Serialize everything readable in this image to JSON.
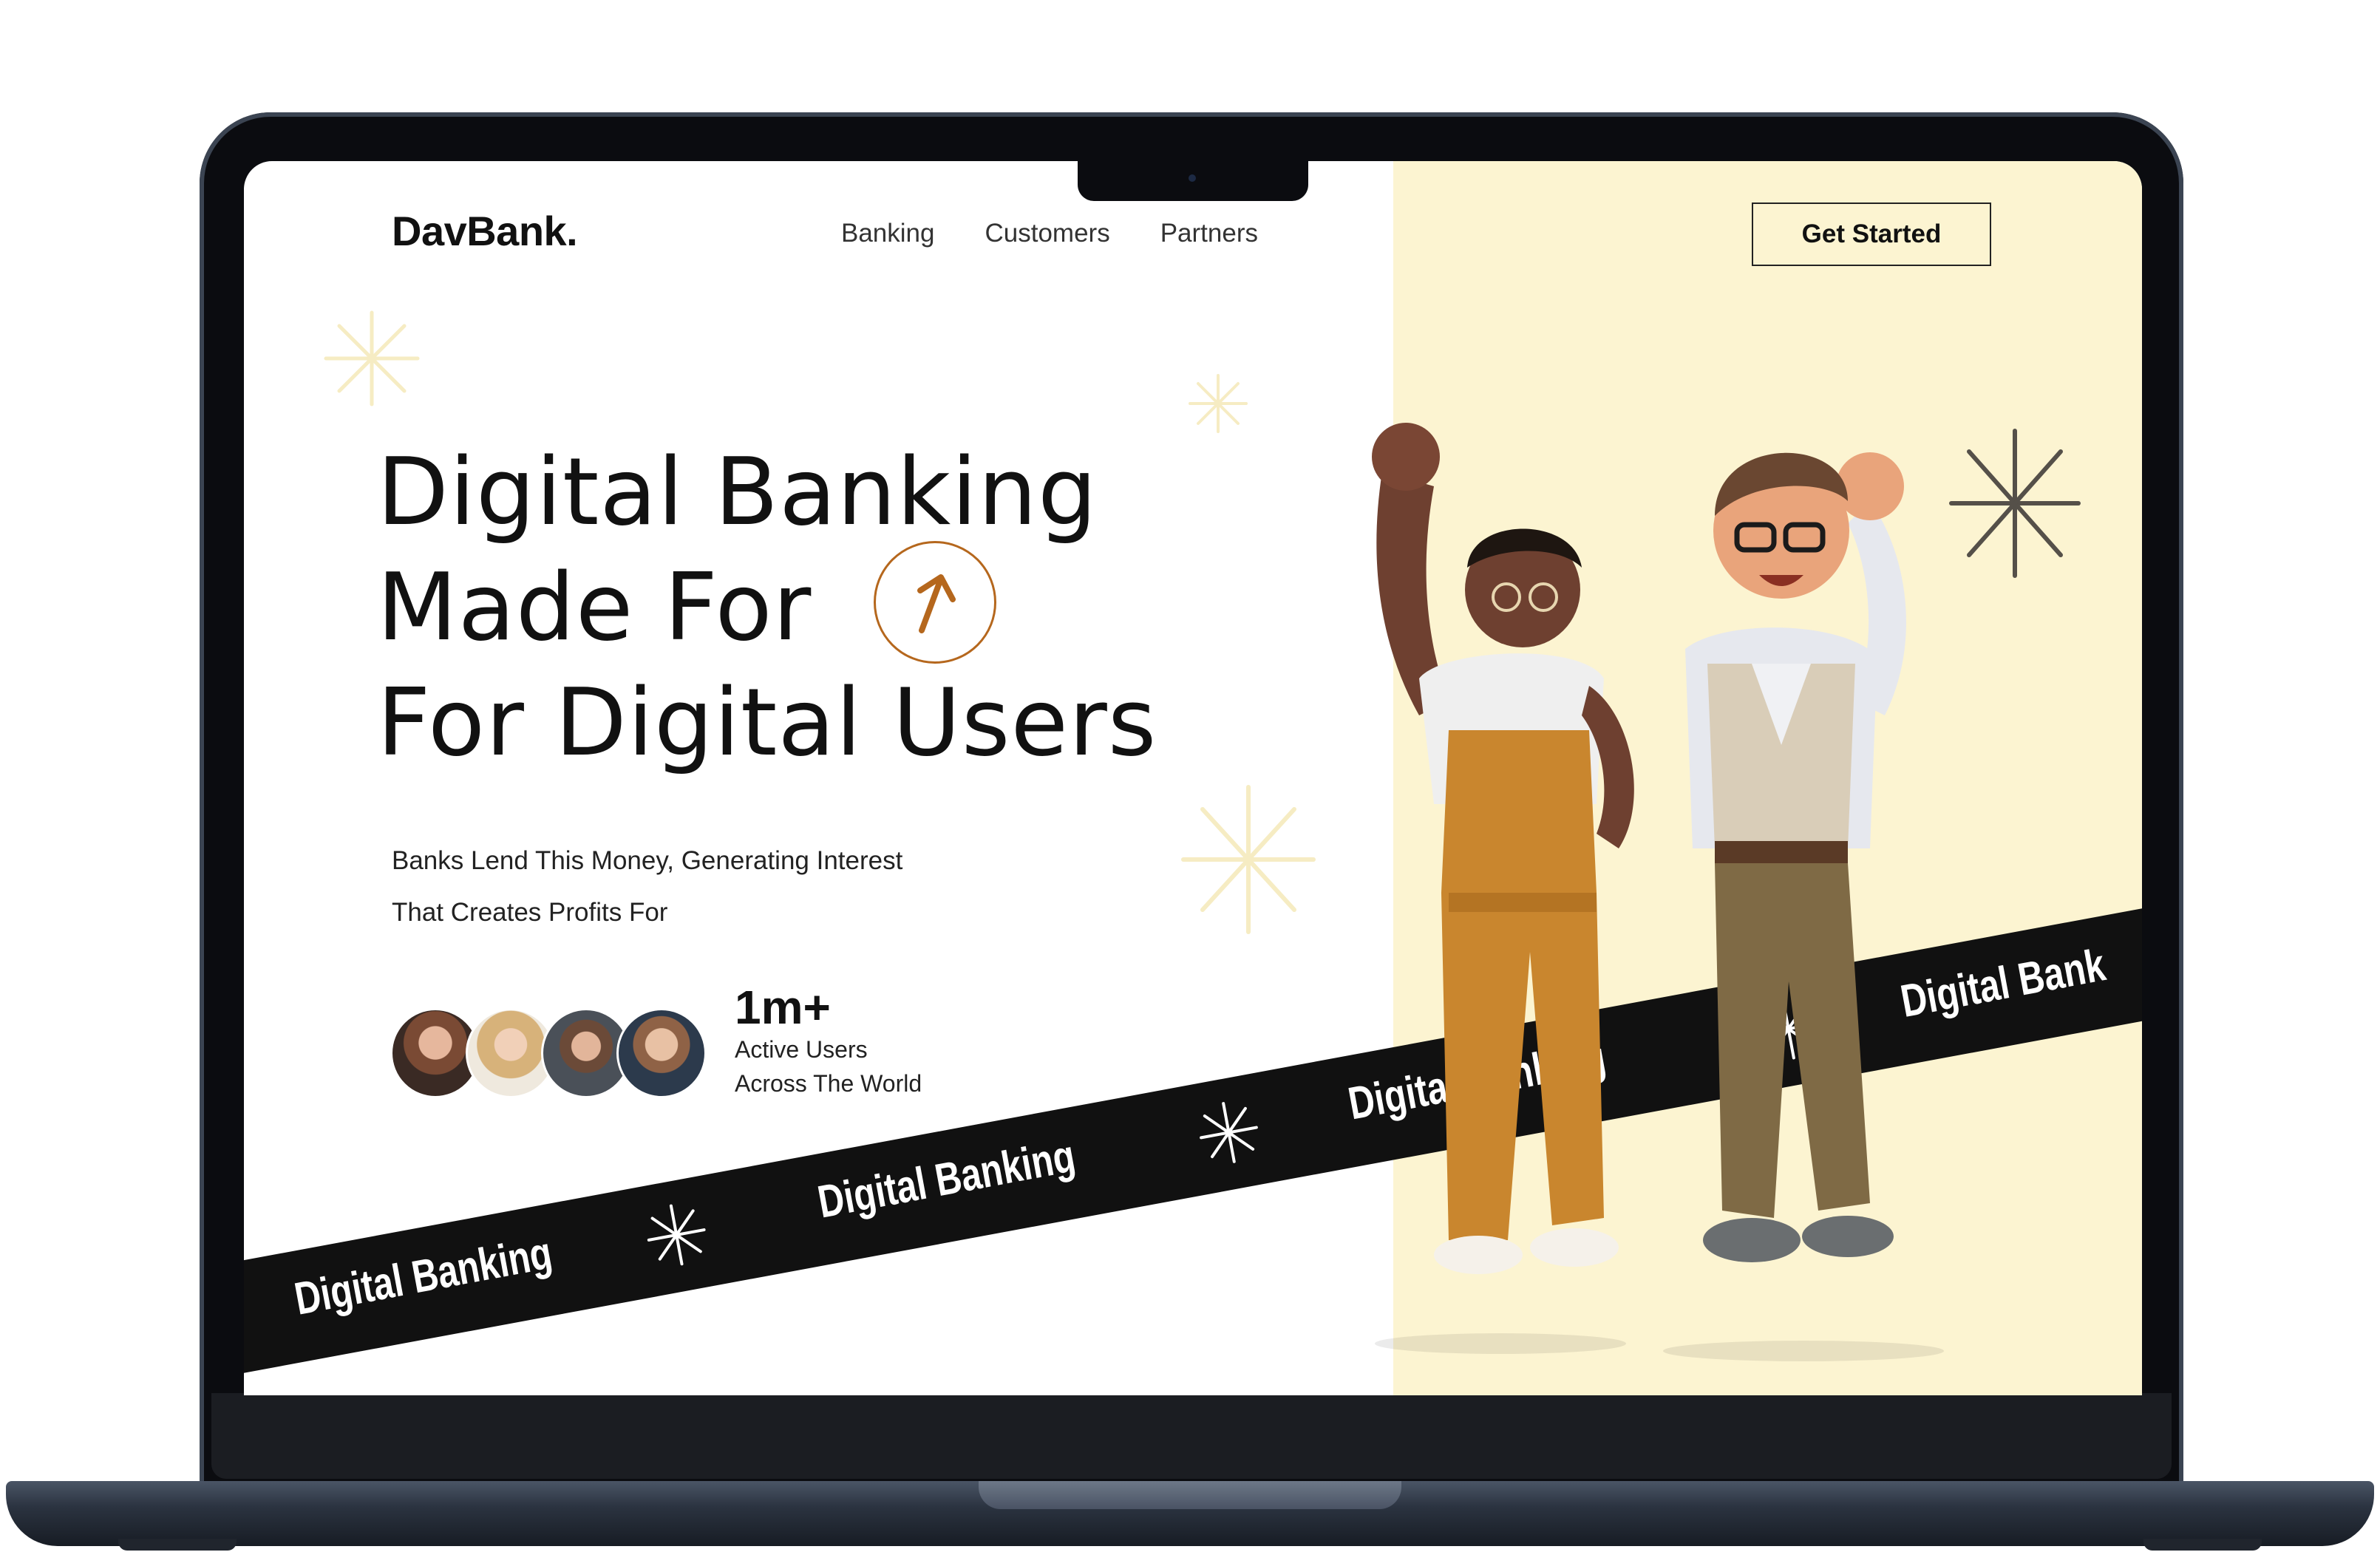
{
  "site": {
    "logo": "DavBank.",
    "nav": [
      "Banking",
      "Customers",
      "Partners"
    ],
    "cta": "Get Started"
  },
  "hero": {
    "title_lines": [
      "Digital Banking",
      "Made For",
      "For Digital Users"
    ],
    "subtitle_lines": [
      "Banks Lend This Money, Generating Interest",
      "That Creates Profits For"
    ],
    "arrow_icon": "arrow-up-right-icon"
  },
  "stats": {
    "value": "1m+",
    "label_line1": "Active Users",
    "label_line2": "Across The World",
    "avatars": [
      "avatar-woman-1",
      "avatar-woman-2",
      "avatar-man-1",
      "avatar-man-2"
    ]
  },
  "ribbon": {
    "items": [
      "Digital Banking",
      "Digital Banking",
      "Digital Banking",
      "Digital Bank"
    ]
  },
  "colors": {
    "accent": "#b5671d",
    "panel": "#fcf4d1",
    "sparkle_light": "#f6ecc3",
    "sparkle_dark": "#555049",
    "ribbon": "#111111"
  }
}
